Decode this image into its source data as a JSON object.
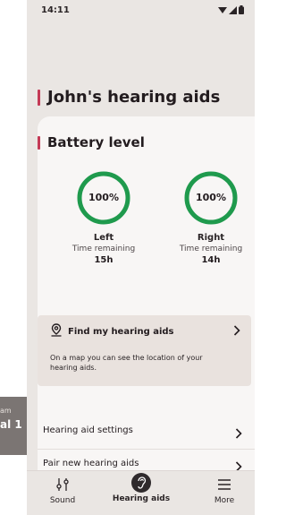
{
  "background_screen": {
    "line1": "am",
    "line2": "al 1"
  },
  "status_bar": {
    "time": "14:11",
    "icons": [
      "wifi-icon",
      "signal-icon",
      "battery-icon"
    ]
  },
  "page": {
    "title": "John's hearing aids"
  },
  "battery": {
    "section_title": "Battery level",
    "accent_color": "#c43a56",
    "ring_color": "#1f9a4d",
    "left": {
      "value": "100%",
      "level": 1.0,
      "side": "Left",
      "remaining_label": "Time remaining",
      "remaining": "15h"
    },
    "right": {
      "value": "100%",
      "level": 1.0,
      "side": "Right",
      "remaining_label": "Time remaining",
      "remaining": "14h"
    }
  },
  "find": {
    "title": "Find my hearing aids",
    "description": "On a map you can see the location of your hearing aids.",
    "icon": "location-pin-icon"
  },
  "menu": {
    "items": [
      {
        "label": "Hearing aid settings"
      },
      {
        "label": "Pair new hearing aids"
      }
    ]
  },
  "bottom_nav": {
    "items": [
      {
        "label": "Sound",
        "icon": "sliders-icon"
      },
      {
        "label": "Hearing aids",
        "icon": "ear-icon",
        "active": true
      },
      {
        "label": "More",
        "icon": "menu-icon"
      }
    ]
  }
}
